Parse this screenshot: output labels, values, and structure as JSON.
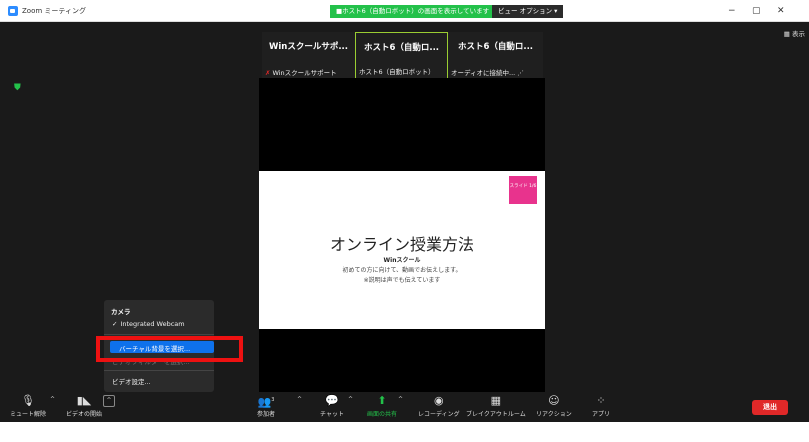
{
  "titlebar": {
    "app_title": "Zoom ミーティング",
    "share_banner": "■ホスト6（自動ロボット）の画面を表示しています",
    "view_options": "ビュー オプション ▾",
    "minimize": "−",
    "restore": "▢",
    "close": "✕"
  },
  "main": {
    "right_label": "▦ 表示"
  },
  "tiles": [
    {
      "name": "Winスクールサポ...",
      "sub": "Winスクールサポート",
      "mic_off": "✗"
    },
    {
      "name": "ホスト6（自動ロ...",
      "sub": "ホスト6（自動ロボット）"
    },
    {
      "name": "ホスト6（自動ロ...",
      "sub": "オーディオに接続中...  ⋰"
    }
  ],
  "slide": {
    "tag": "スライド 1/6",
    "title": "オンライン授業方法",
    "sub1": "Winスクール",
    "sub2": "初めての方に向けて、動画でお伝えします。",
    "sub3": "※説明は声でも伝えています"
  },
  "popup": {
    "header": "カメラ",
    "check": "✓",
    "webcam": "Integrated Webcam",
    "virtual_bg": "バーチャル背景を選択...",
    "video_filter": "ビデオフィルターを選択...",
    "video_settings": "ビデオ設定..."
  },
  "toolbar": {
    "mute": "ミュート解除",
    "video": "ビデオの開始",
    "participants": "参加者",
    "participants_count": "3",
    "chat": "チャット",
    "share": "画面の共有",
    "record": "レコーディング",
    "breakout": "ブレイクアウトルーム",
    "reactions": "リアクション",
    "apps": "アプリ",
    "end": "退出"
  }
}
